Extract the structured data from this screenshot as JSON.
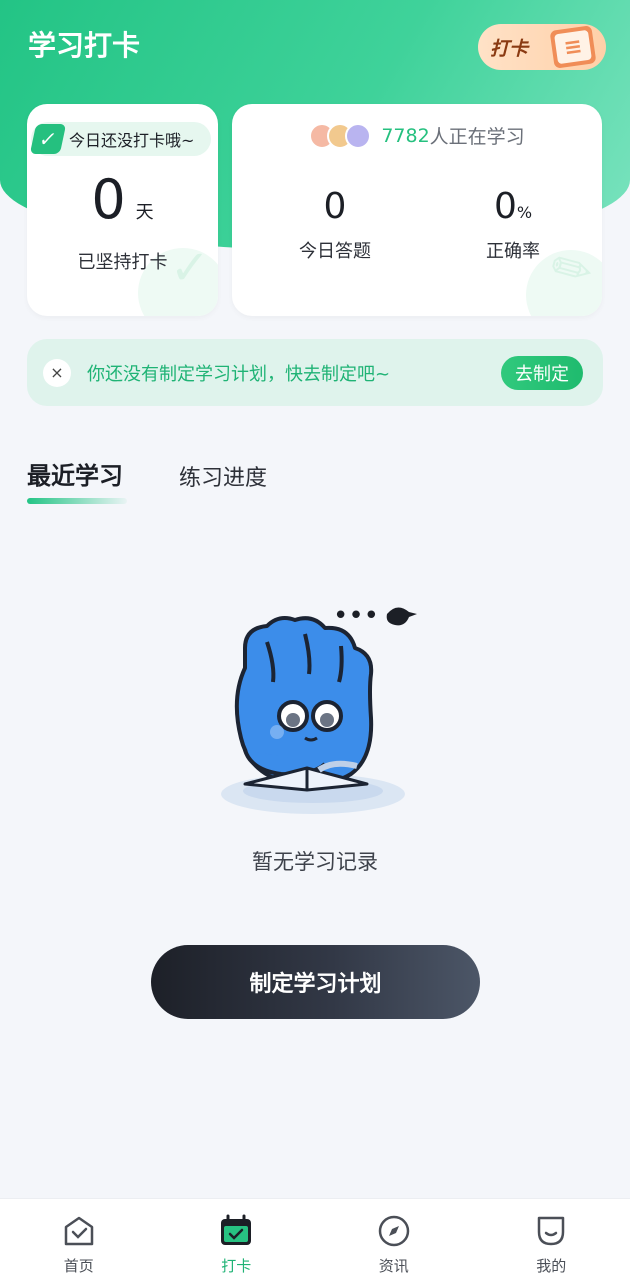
{
  "header": {
    "title": "学习打卡",
    "badge_label": "打卡",
    "badge_icon": "notebook-icon"
  },
  "checkin_card": {
    "status_tag": "今日还没打卡哦~",
    "days": "0",
    "days_unit": "天",
    "caption": "已坚持打卡"
  },
  "stats_card": {
    "learners_count": "7782",
    "learners_text": "人正在学习",
    "today_questions": "0",
    "today_questions_label": "今日答题",
    "accuracy": "0",
    "accuracy_unit": "%",
    "accuracy_label": "正确率"
  },
  "plan_banner": {
    "text": "你还没有制定学习计划，快去制定吧~",
    "action_label": "去制定",
    "close_icon": "×"
  },
  "tabs": [
    {
      "label": "最近学习",
      "active": true
    },
    {
      "label": "练习进度",
      "active": false
    }
  ],
  "empty_state": {
    "text": "暂无学习记录",
    "dots": "•••"
  },
  "primary_action": {
    "label": "制定学习计划"
  },
  "tabbar": {
    "items": [
      {
        "label": "首页",
        "icon": "home-icon",
        "active": false
      },
      {
        "label": "打卡",
        "icon": "calendar-check-icon",
        "active": true
      },
      {
        "label": "资讯",
        "icon": "compass-icon",
        "active": false
      },
      {
        "label": "我的",
        "icon": "profile-icon",
        "active": false
      }
    ]
  },
  "colors": {
    "brand_green": "#23c485",
    "button_dark": "#1d2028",
    "banner_bg": "#dff3ec"
  }
}
